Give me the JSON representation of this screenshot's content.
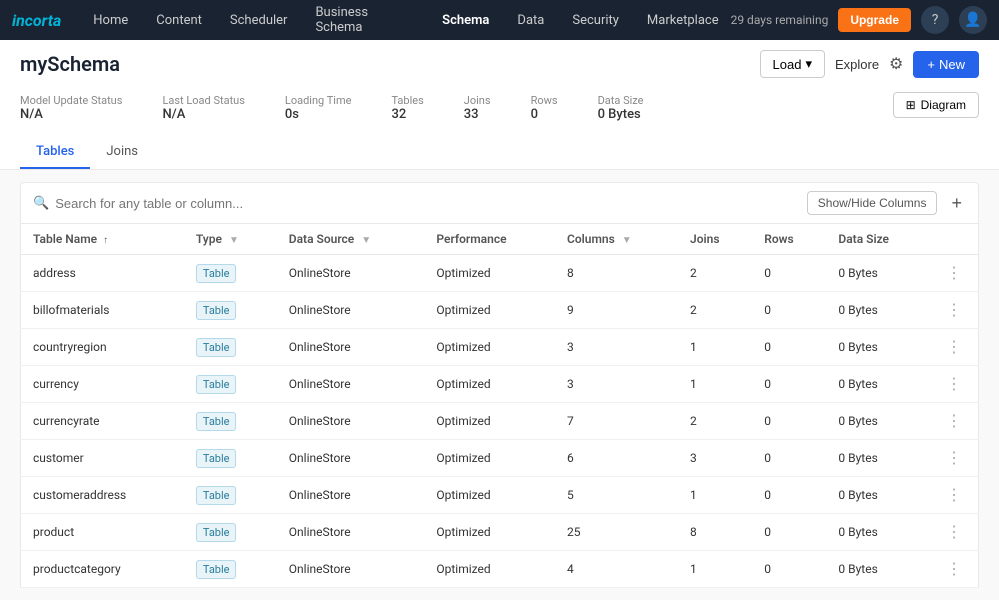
{
  "topnav": {
    "logo": "incorta",
    "items": [
      {
        "label": "Home",
        "active": false
      },
      {
        "label": "Content",
        "active": false
      },
      {
        "label": "Scheduler",
        "active": false
      },
      {
        "label": "Business Schema",
        "active": false
      },
      {
        "label": "Schema",
        "active": true
      },
      {
        "label": "Data",
        "active": false
      },
      {
        "label": "Security",
        "active": false
      },
      {
        "label": "Marketplace",
        "active": false
      }
    ],
    "days_remaining": "29 days remaining",
    "upgrade_label": "Upgrade"
  },
  "page": {
    "title": "mySchema",
    "load_btn": "Load",
    "explore_btn": "Explore",
    "new_btn": "New",
    "diagram_btn": "Diagram"
  },
  "stats": [
    {
      "label": "Model Update Status",
      "value": "N/A"
    },
    {
      "label": "Last Load Status",
      "value": "N/A"
    },
    {
      "label": "Loading Time",
      "value": "0s"
    },
    {
      "label": "Tables",
      "value": "32"
    },
    {
      "label": "Joins",
      "value": "33"
    },
    {
      "label": "Rows",
      "value": "0"
    },
    {
      "label": "Data Size",
      "value": "0 Bytes"
    }
  ],
  "tabs": [
    {
      "label": "Tables",
      "active": true
    },
    {
      "label": "Joins",
      "active": false
    }
  ],
  "toolbar": {
    "search_placeholder": "Search for any table or column...",
    "show_hide_label": "Show/Hide Columns"
  },
  "table": {
    "columns": [
      {
        "label": "Table Name",
        "sortable": true,
        "filterable": false
      },
      {
        "label": "Type",
        "sortable": false,
        "filterable": true
      },
      {
        "label": "Data Source",
        "sortable": false,
        "filterable": true
      },
      {
        "label": "Performance",
        "sortable": false,
        "filterable": false
      },
      {
        "label": "Columns",
        "sortable": false,
        "filterable": true
      },
      {
        "label": "Joins",
        "sortable": false,
        "filterable": false
      },
      {
        "label": "Rows",
        "sortable": false,
        "filterable": false
      },
      {
        "label": "Data Size",
        "sortable": false,
        "filterable": false
      }
    ],
    "rows": [
      {
        "name": "address",
        "type": "Table",
        "datasource": "OnlineStore",
        "performance": "Optimized",
        "columns": "8",
        "joins": "2",
        "rows": "0",
        "datasize": "0 Bytes"
      },
      {
        "name": "billofmaterials",
        "type": "Table",
        "datasource": "OnlineStore",
        "performance": "Optimized",
        "columns": "9",
        "joins": "2",
        "rows": "0",
        "datasize": "0 Bytes"
      },
      {
        "name": "countryregion",
        "type": "Table",
        "datasource": "OnlineStore",
        "performance": "Optimized",
        "columns": "3",
        "joins": "1",
        "rows": "0",
        "datasize": "0 Bytes"
      },
      {
        "name": "currency",
        "type": "Table",
        "datasource": "OnlineStore",
        "performance": "Optimized",
        "columns": "3",
        "joins": "1",
        "rows": "0",
        "datasize": "0 Bytes"
      },
      {
        "name": "currencyrate",
        "type": "Table",
        "datasource": "OnlineStore",
        "performance": "Optimized",
        "columns": "7",
        "joins": "2",
        "rows": "0",
        "datasize": "0 Bytes"
      },
      {
        "name": "customer",
        "type": "Table",
        "datasource": "OnlineStore",
        "performance": "Optimized",
        "columns": "6",
        "joins": "3",
        "rows": "0",
        "datasize": "0 Bytes"
      },
      {
        "name": "customeraddress",
        "type": "Table",
        "datasource": "OnlineStore",
        "performance": "Optimized",
        "columns": "5",
        "joins": "1",
        "rows": "0",
        "datasize": "0 Bytes"
      },
      {
        "name": "product",
        "type": "Table",
        "datasource": "OnlineStore",
        "performance": "Optimized",
        "columns": "25",
        "joins": "8",
        "rows": "0",
        "datasize": "0 Bytes"
      },
      {
        "name": "productcategory",
        "type": "Table",
        "datasource": "OnlineStore",
        "performance": "Optimized",
        "columns": "4",
        "joins": "1",
        "rows": "0",
        "datasize": "0 Bytes"
      }
    ]
  }
}
